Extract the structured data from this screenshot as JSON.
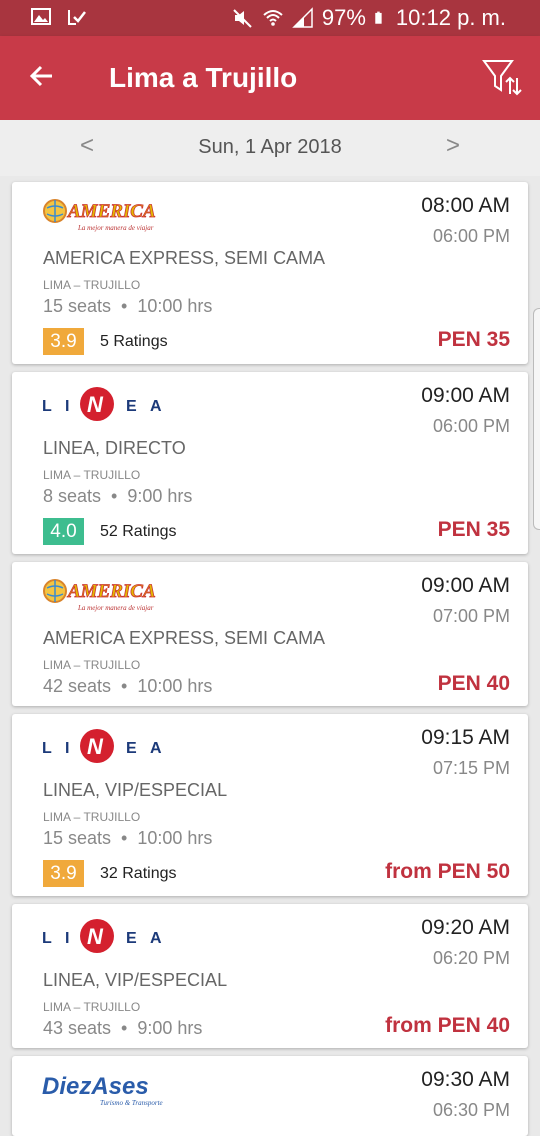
{
  "status_bar": {
    "battery": "97%",
    "time": "10:12 p. m."
  },
  "header": {
    "title": "Lima a Trujillo"
  },
  "date_nav": {
    "prev": "<",
    "date": "Sun, 1 Apr 2018",
    "next": ">"
  },
  "trips": [
    {
      "logo": "AMERICA",
      "logo_tagline": "La mejor manera de viajar",
      "depart": "08:00 AM",
      "arrive": "06:00 PM",
      "operator": "AMERICA EXPRESS, SEMI CAMA",
      "route": "LIMA – TRUJILLO",
      "seats": "15 seats",
      "duration": "10:00 hrs",
      "rating": "3.9",
      "ratings_count": "5 Ratings",
      "price": "PEN 35"
    },
    {
      "logo": "LINEA",
      "depart": "09:00 AM",
      "arrive": "06:00 PM",
      "operator": "LINEA, DIRECTO",
      "route": "LIMA – TRUJILLO",
      "seats": "8 seats",
      "duration": "9:00 hrs",
      "rating": "4.0",
      "ratings_count": "52 Ratings",
      "price": "PEN 35"
    },
    {
      "logo": "AMERICA",
      "logo_tagline": "La mejor manera de viajar",
      "depart": "09:00 AM",
      "arrive": "07:00 PM",
      "operator": "AMERICA EXPRESS, SEMI CAMA",
      "route": "LIMA – TRUJILLO",
      "seats": "42 seats",
      "duration": "10:00 hrs",
      "price": "PEN 40"
    },
    {
      "logo": "LINEA",
      "depart": "09:15 AM",
      "arrive": "07:15 PM",
      "operator": "LINEA, VIP/ESPECIAL",
      "route": "LIMA – TRUJILLO",
      "seats": "15 seats",
      "duration": "10:00 hrs",
      "rating": "3.9",
      "ratings_count": "32 Ratings",
      "price": "from PEN 50"
    },
    {
      "logo": "LINEA",
      "depart": "09:20 AM",
      "arrive": "06:20 PM",
      "operator": "LINEA, VIP/ESPECIAL",
      "route": "LIMA – TRUJILLO",
      "seats": "43 seats",
      "duration": "9:00 hrs",
      "price": "from PEN 40"
    },
    {
      "logo": "DiezAses",
      "logo_tagline": "Turismo & Transporte",
      "depart": "09:30 AM",
      "arrive": "06:30 PM"
    }
  ],
  "colors": {
    "status_bar": "#a8353f",
    "app_bar": "#c83a48",
    "price": "#c0323f",
    "rating_orange": "#f0a93b",
    "rating_green": "#3dbd8f"
  }
}
